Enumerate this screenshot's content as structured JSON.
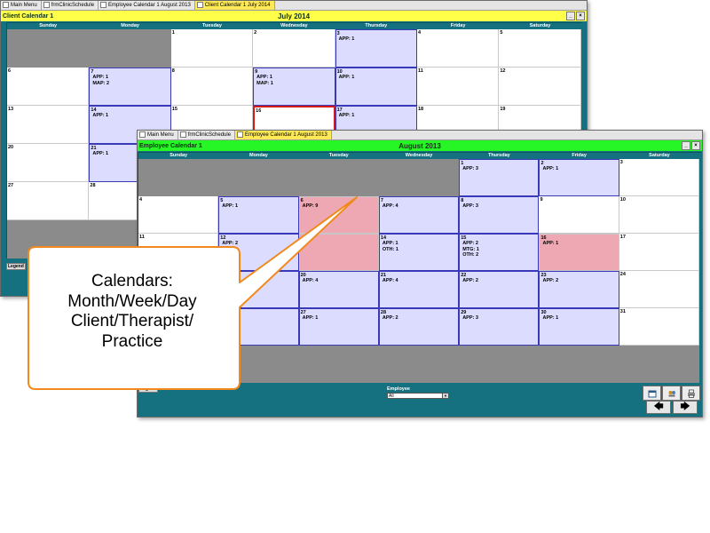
{
  "back_window": {
    "tabs": [
      {
        "label": "Main Menu",
        "active": false
      },
      {
        "label": "frmClinicSchedule",
        "active": false
      },
      {
        "label": "Employee Calendar 1 August  2013",
        "active": false
      },
      {
        "label": "Client Calendar 1 July  2014",
        "active": true
      }
    ],
    "form_title": "Client Calendar 1",
    "month_title": "July  2014",
    "titlebar_color": "#ffff4a",
    "weekdays": [
      "Sunday",
      "Monday",
      "Tuesday",
      "Wednesday",
      "Thursday",
      "Friday",
      "Saturday"
    ],
    "cells": [
      {
        "day": "",
        "type": "gray",
        "events": []
      },
      {
        "day": "",
        "type": "gray",
        "events": []
      },
      {
        "day": "1",
        "type": "normal",
        "events": []
      },
      {
        "day": "2",
        "type": "normal",
        "events": []
      },
      {
        "day": "3",
        "type": "appt",
        "events": [
          "APP: 1"
        ]
      },
      {
        "day": "4",
        "type": "normal",
        "events": []
      },
      {
        "day": "5",
        "type": "normal",
        "events": []
      },
      {
        "day": "6",
        "type": "normal",
        "events": []
      },
      {
        "day": "7",
        "type": "appt",
        "events": [
          "APP: 1",
          "MAP: 2"
        ]
      },
      {
        "day": "8",
        "type": "normal",
        "events": []
      },
      {
        "day": "9",
        "type": "appt",
        "events": [
          "APP: 1",
          "MAP: 1"
        ]
      },
      {
        "day": "10",
        "type": "appt",
        "events": [
          "APP: 1"
        ]
      },
      {
        "day": "11",
        "type": "normal",
        "events": []
      },
      {
        "day": "12",
        "type": "normal",
        "events": []
      },
      {
        "day": "13",
        "type": "normal",
        "events": []
      },
      {
        "day": "14",
        "type": "appt",
        "events": [
          "APP: 1"
        ]
      },
      {
        "day": "15",
        "type": "normal",
        "events": []
      },
      {
        "day": "16",
        "type": "today",
        "events": []
      },
      {
        "day": "17",
        "type": "appt",
        "events": [
          "APP: 1"
        ]
      },
      {
        "day": "18",
        "type": "normal",
        "events": []
      },
      {
        "day": "19",
        "type": "normal",
        "events": []
      },
      {
        "day": "20",
        "type": "normal",
        "events": []
      },
      {
        "day": "21",
        "type": "appt",
        "events": [
          "APP: 1"
        ]
      },
      {
        "day": "",
        "type": "normal",
        "events": []
      },
      {
        "day": "",
        "type": "normal",
        "events": []
      },
      {
        "day": "",
        "type": "normal",
        "events": []
      },
      {
        "day": "",
        "type": "normal",
        "events": []
      },
      {
        "day": "",
        "type": "normal",
        "events": []
      },
      {
        "day": "27",
        "type": "normal",
        "events": []
      },
      {
        "day": "28",
        "type": "normal",
        "events": []
      },
      {
        "day": "",
        "type": "normal",
        "events": []
      },
      {
        "day": "",
        "type": "normal",
        "events": []
      },
      {
        "day": "",
        "type": "normal",
        "events": []
      },
      {
        "day": "",
        "type": "normal",
        "events": []
      },
      {
        "day": "",
        "type": "normal",
        "events": []
      },
      {
        "day": "",
        "type": "gray",
        "events": []
      },
      {
        "day": "",
        "type": "gray",
        "events": []
      },
      {
        "day": "",
        "type": "gray",
        "events": []
      },
      {
        "day": "",
        "type": "gray",
        "events": []
      },
      {
        "day": "",
        "type": "gray",
        "events": []
      },
      {
        "day": "",
        "type": "gray",
        "events": []
      },
      {
        "day": "",
        "type": "gray",
        "events": []
      }
    ],
    "legend_label": "Legend"
  },
  "front_window": {
    "tabs": [
      {
        "label": "Main Menu",
        "active": false
      },
      {
        "label": "frmClinicSchedule",
        "active": false
      },
      {
        "label": "Employee Calendar 1 August  2013",
        "active": true
      }
    ],
    "form_title": "Employee Calendar 1",
    "month_title": "August  2013",
    "titlebar_color": "#26f526",
    "weekdays": [
      "Sunday",
      "Monday",
      "Tuesday",
      "Wednesday",
      "Thursday",
      "Friday",
      "Saturday"
    ],
    "cells": [
      {
        "day": "",
        "type": "gray",
        "events": []
      },
      {
        "day": "",
        "type": "gray",
        "events": []
      },
      {
        "day": "",
        "type": "gray",
        "events": []
      },
      {
        "day": "",
        "type": "gray",
        "events": []
      },
      {
        "day": "1",
        "type": "appt",
        "events": [
          "APP: 3"
        ]
      },
      {
        "day": "2",
        "type": "appt",
        "events": [
          "APP: 1"
        ]
      },
      {
        "day": "3",
        "type": "normal",
        "events": []
      },
      {
        "day": "4",
        "type": "normal",
        "events": []
      },
      {
        "day": "5",
        "type": "appt",
        "events": [
          "APP: 1"
        ]
      },
      {
        "day": "6",
        "type": "pink",
        "events": [
          "APP: 9"
        ]
      },
      {
        "day": "7",
        "type": "appt",
        "events": [
          "APP: 4"
        ]
      },
      {
        "day": "8",
        "type": "appt",
        "events": [
          "APP: 3"
        ]
      },
      {
        "day": "9",
        "type": "normal",
        "events": []
      },
      {
        "day": "10",
        "type": "normal",
        "events": []
      },
      {
        "day": "11",
        "type": "normal",
        "events": []
      },
      {
        "day": "12",
        "type": "appt",
        "events": [
          "APP: 2"
        ]
      },
      {
        "day": "",
        "type": "pink",
        "events": []
      },
      {
        "day": "14",
        "type": "appt",
        "events": [
          "APP: 1",
          "OTH: 1"
        ]
      },
      {
        "day": "15",
        "type": "appt",
        "events": [
          "APP: 2",
          "MTG: 1",
          "OTH: 2"
        ]
      },
      {
        "day": "16",
        "type": "pink",
        "events": [
          "APP: 1"
        ]
      },
      {
        "day": "17",
        "type": "normal",
        "events": []
      },
      {
        "day": "",
        "type": "normal",
        "events": []
      },
      {
        "day": "",
        "type": "appt",
        "events": []
      },
      {
        "day": "20",
        "type": "appt",
        "events": [
          "APP: 4"
        ]
      },
      {
        "day": "21",
        "type": "appt",
        "events": [
          "APP: 4"
        ]
      },
      {
        "day": "22",
        "type": "appt",
        "events": [
          "APP: 2"
        ]
      },
      {
        "day": "23",
        "type": "appt",
        "events": [
          "APP: 2"
        ]
      },
      {
        "day": "24",
        "type": "normal",
        "events": []
      },
      {
        "day": "",
        "type": "normal",
        "events": []
      },
      {
        "day": "",
        "type": "appt",
        "events": []
      },
      {
        "day": "27",
        "type": "appt",
        "events": [
          "APP: 1"
        ]
      },
      {
        "day": "28",
        "type": "appt",
        "events": [
          "APP: 2"
        ]
      },
      {
        "day": "29",
        "type": "appt",
        "events": [
          "APP: 3"
        ]
      },
      {
        "day": "30",
        "type": "appt",
        "events": [
          "APP: 1"
        ]
      },
      {
        "day": "31",
        "type": "normal",
        "events": []
      },
      {
        "day": "",
        "type": "gray",
        "events": []
      },
      {
        "day": "",
        "type": "gray",
        "events": []
      },
      {
        "day": "",
        "type": "gray",
        "events": []
      },
      {
        "day": "",
        "type": "gray",
        "events": []
      },
      {
        "day": "",
        "type": "gray",
        "events": []
      },
      {
        "day": "",
        "type": "gray",
        "events": []
      },
      {
        "day": "",
        "type": "gray",
        "events": []
      }
    ],
    "legend_label": "Legend",
    "employee_label": "Employee",
    "employee_value": "All",
    "nav_prev": "🡄",
    "nav_next": "🡆"
  },
  "callout": {
    "lines": [
      "Calendars:",
      "Month/Week/Day",
      "Client/Therapist/",
      "Practice"
    ],
    "border_color": "#f08a1e"
  },
  "colors": {
    "frame": "#15707f",
    "appt_cell": "#dcdcff",
    "appt_border": "#3a3ab8",
    "holiday_cell": "#eda8b4",
    "empty_cell": "#8b8b8b",
    "today_border": "#d61a1a"
  }
}
